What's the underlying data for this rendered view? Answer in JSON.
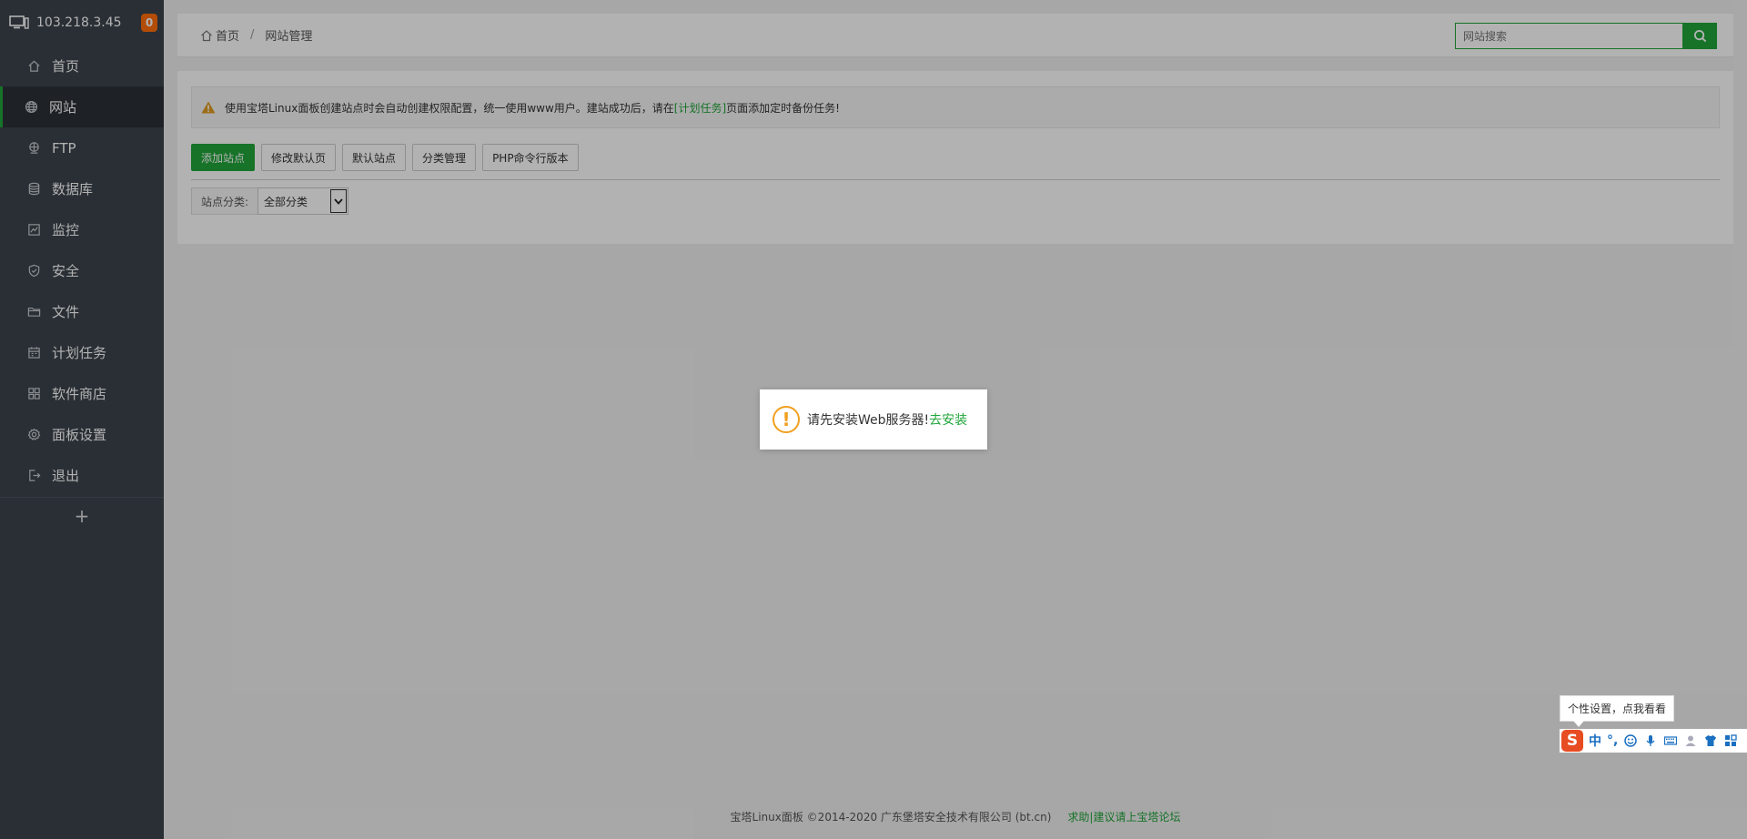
{
  "sidebar": {
    "ip": "103.218.3.45",
    "badge": "0",
    "items": [
      {
        "label": "首页",
        "icon": "home-icon"
      },
      {
        "label": "网站",
        "icon": "globe-icon",
        "active": true
      },
      {
        "label": "FTP",
        "icon": "ftp-icon"
      },
      {
        "label": "数据库",
        "icon": "database-icon"
      },
      {
        "label": "监控",
        "icon": "monitor-icon"
      },
      {
        "label": "安全",
        "icon": "shield-icon"
      },
      {
        "label": "文件",
        "icon": "folder-icon"
      },
      {
        "label": "计划任务",
        "icon": "calendar-icon"
      },
      {
        "label": "软件商店",
        "icon": "grid-icon"
      },
      {
        "label": "面板设置",
        "icon": "gear-icon"
      },
      {
        "label": "退出",
        "icon": "logout-icon"
      }
    ],
    "add": "+"
  },
  "breadcrumb": {
    "home": "首页",
    "sep": "/",
    "current": "网站管理"
  },
  "search": {
    "placeholder": "网站搜索"
  },
  "notice": {
    "text_before": "使用宝塔Linux面板创建站点时会自动创建权限配置，统一使用www用户。建站成功后，请在",
    "link": "[计划任务]",
    "text_after": "页面添加定时备份任务!"
  },
  "buttons": {
    "add_site": "添加站点",
    "modify_default": "修改默认页",
    "default_site": "默认站点",
    "category_manage": "分类管理",
    "php_cli": "PHP命令行版本"
  },
  "category": {
    "label": "站点分类:",
    "selected": "全部分类"
  },
  "footer": {
    "copyright": "宝塔Linux面板 ©2014-2020 广东堡塔安全技术有限公司 (bt.cn)",
    "help": "求助|建议请上宝塔论坛"
  },
  "dialog": {
    "message": "请先安装Web服务器!",
    "install": "去安装"
  },
  "ime": {
    "tip": "个性设置，点我看看",
    "logo": "S",
    "lang": "中",
    "punct": "°,"
  },
  "colors": {
    "accent": "#20a53a",
    "sidebar": "#3c444d",
    "badge": "#ff6e0b",
    "warning": "#f0a020"
  }
}
